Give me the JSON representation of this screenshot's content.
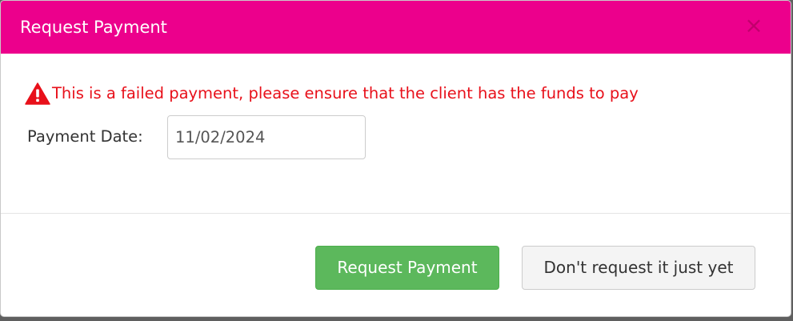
{
  "modal": {
    "title": "Request Payment",
    "close_symbol": "×"
  },
  "alert": {
    "icon": "warning-icon",
    "message": "This is a failed payment, please ensure that the client has the funds to pay",
    "color": "#e8101a"
  },
  "form": {
    "payment_date_label": "Payment Date:",
    "payment_date_value": "11/02/2024"
  },
  "footer": {
    "request_button_label": "Request Payment",
    "defer_button_label": "Don't request it just yet"
  },
  "colors": {
    "header": "#ec008c",
    "primary_button": "#5cb85c",
    "secondary_button": "#f4f4f4"
  }
}
